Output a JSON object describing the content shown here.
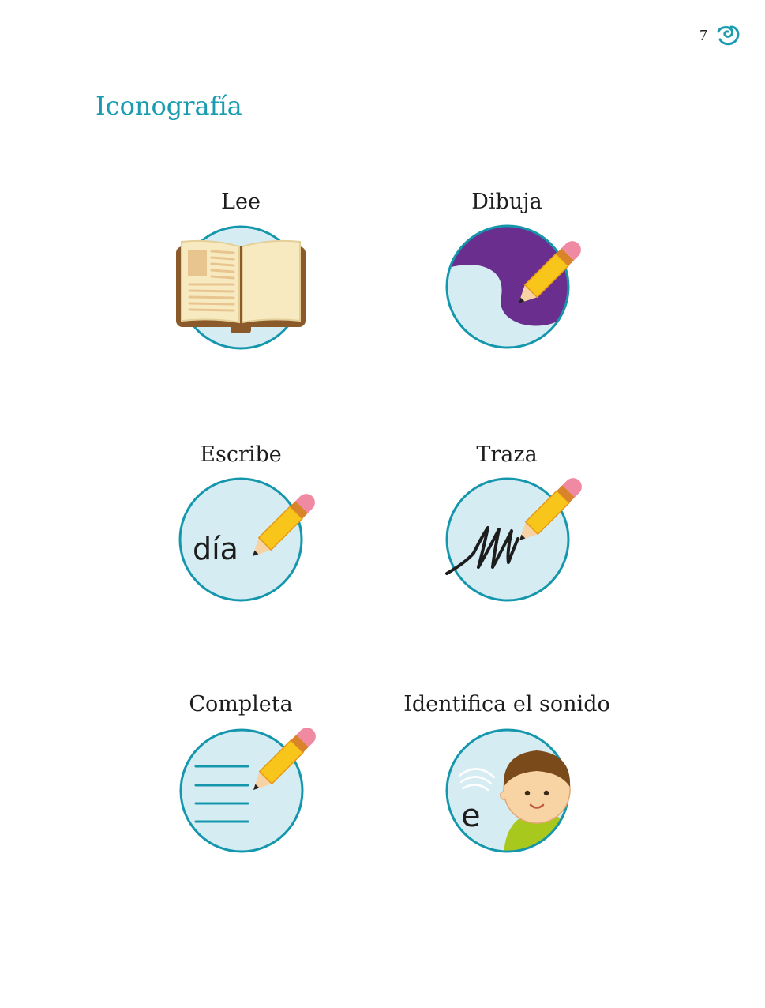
{
  "page": {
    "number": "7",
    "title": "Iconografía"
  },
  "icons": [
    {
      "label": "Lee",
      "icon": "book-icon"
    },
    {
      "label": "Dibuja",
      "icon": "draw-pencil-icon"
    },
    {
      "label": "Escribe",
      "icon": "write-pencil-icon",
      "sample_text": "día"
    },
    {
      "label": "Traza",
      "icon": "trace-pencil-icon"
    },
    {
      "label": "Completa",
      "icon": "complete-lines-icon"
    },
    {
      "label": "Identifica el sonido",
      "icon": "listening-child-icon",
      "sample_text": "e"
    }
  ],
  "colors": {
    "accent": "#1a9cb0",
    "circle_fill": "#d6ecf3",
    "circle_stroke": "#1497ad",
    "pencil": "#f8c51a",
    "eraser": "#f08aa3",
    "purple": "#6a2f8e",
    "shirt": "#a8c81e"
  }
}
